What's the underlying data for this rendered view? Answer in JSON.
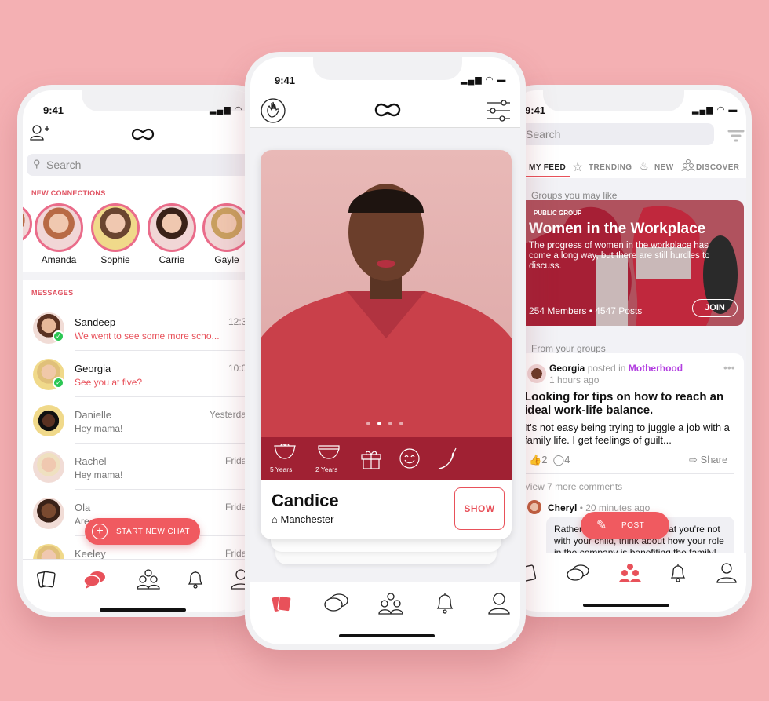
{
  "status": {
    "time": "9:41"
  },
  "left": {
    "search_placeholder": "Search",
    "new_connections_label": "NEW CONNECTIONS",
    "connections": [
      "Amanda",
      "Sophie",
      "Carrie",
      "Gayle"
    ],
    "messages_label": "MESSAGES",
    "messages": [
      {
        "name": "Sandeep",
        "preview": "We went to see some more scho...",
        "time": "12:3",
        "unread": true
      },
      {
        "name": "Georgia",
        "preview": "See you at five?",
        "time": "10:0",
        "unread": true
      },
      {
        "name": "Danielle",
        "preview": "Hey mama!",
        "time": "Yesterda",
        "unread": false
      },
      {
        "name": "Rachel",
        "preview": "Hey mama!",
        "time": "Frida",
        "unread": false
      },
      {
        "name": "Ola",
        "preview": "Are",
        "time": "Frida",
        "unread": false
      },
      {
        "name": "Keeley",
        "preview": "",
        "time": "Frida",
        "unread": false
      }
    ],
    "fab_label": "START NEW CHAT"
  },
  "center": {
    "profile": {
      "name": "Candice",
      "location": "Manchester",
      "show_label": "SHOW",
      "traits": [
        {
          "icon": "diaper-bow-icon",
          "label": "5 Years"
        },
        {
          "icon": "diaper-icon",
          "label": "2 Years"
        },
        {
          "icon": "gift-icon",
          "label": ""
        },
        {
          "icon": "smiley-icon",
          "label": ""
        },
        {
          "icon": "chili-icon",
          "label": ""
        }
      ],
      "photo_index": 2,
      "photo_count": 4
    }
  },
  "right": {
    "search_placeholder": "Search",
    "tabs": [
      "MY FEED",
      "TRENDING",
      "NEW",
      "DISCOVER"
    ],
    "active_tab": "MY FEED",
    "groups_label": "Groups you may like",
    "group": {
      "type": "PUBLIC GROUP",
      "title": "Women in the Workplace",
      "description": "The progress of women in the workplace has come a long way, but there are still hurdles to discuss.",
      "stats": "254 Members • 4547 Posts",
      "join_label": "JOIN"
    },
    "from_groups_label": "From your groups",
    "post": {
      "author": "Georgia",
      "posted_in": "posted in",
      "group": "Motherhood",
      "time": "1 hours ago",
      "title": "Looking for tips on how to reach an ideal work-life balance.",
      "body": "It's not easy being trying to juggle a job with a family life. I get feelings of guilt...",
      "likes": "2",
      "comments": "4",
      "share_label": "Share",
      "more_comments": "View 7 more comments",
      "comment": {
        "author": "Cheryl",
        "time": "• 20 minutes ago",
        "text": "Rather than feeling guilty that you're not with your child, think about how your role in the company is benefiting the family!"
      }
    },
    "fab_label": "POST"
  },
  "colors": {
    "accent": "#e8515a",
    "background": "#f4b0b3",
    "group_link": "#b23ee0",
    "online": "#2bc653"
  }
}
